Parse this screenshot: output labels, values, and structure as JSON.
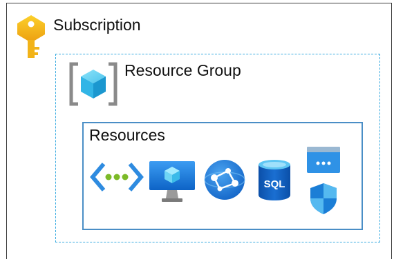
{
  "subscription": {
    "title": "Subscription",
    "icon": "key-icon",
    "icon_color": "#f2b318"
  },
  "resource_group": {
    "title": "Resource Group",
    "icon": "resource-group-icon",
    "border_color": "#35a9e0"
  },
  "resources": {
    "title": "Resources",
    "border_color": "#4a8ec6",
    "items": [
      {
        "icon": "virtual-network-icon"
      },
      {
        "icon": "virtual-machine-icon"
      },
      {
        "icon": "cosmos-db-icon"
      },
      {
        "icon": "sql-database-icon",
        "label": "SQL"
      },
      {
        "icon": "app-service-icon"
      },
      {
        "icon": "security-shield-icon"
      }
    ]
  }
}
